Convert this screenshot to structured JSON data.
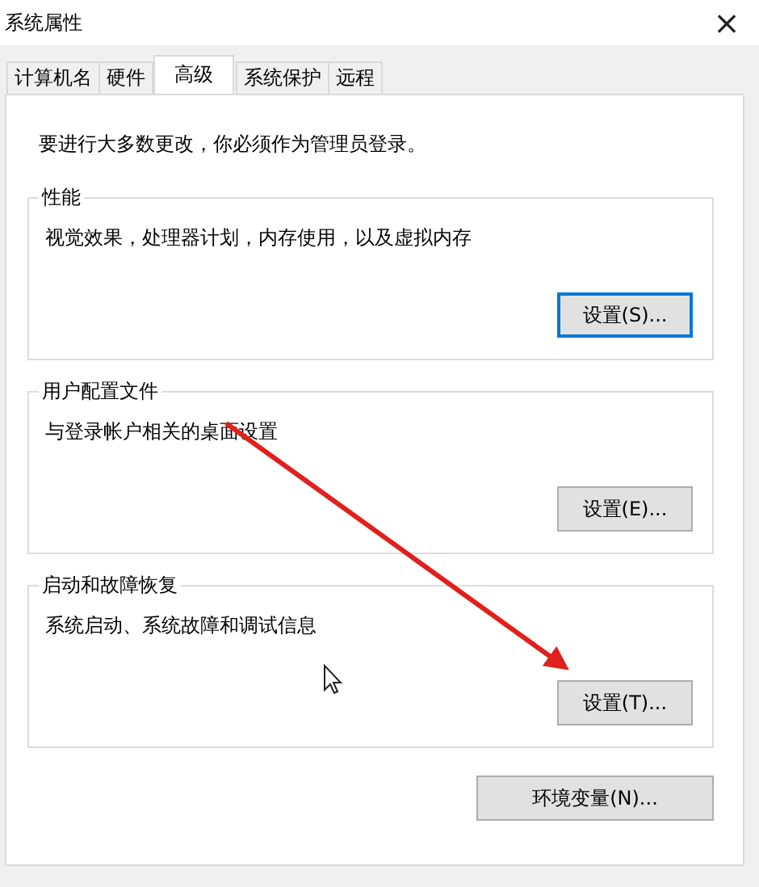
{
  "window": {
    "title": "系统属性",
    "close": "×"
  },
  "tabs": [
    {
      "label": "计算机名",
      "selected": false
    },
    {
      "label": "硬件",
      "selected": false
    },
    {
      "label": "高级",
      "selected": true
    },
    {
      "label": "系统保护",
      "selected": false
    },
    {
      "label": "远程",
      "selected": false
    }
  ],
  "notice": "要进行大多数更改，你必须作为管理员登录。",
  "groups": [
    {
      "title": "性能",
      "description": "视觉效果，处理器计划，内存使用，以及虚拟内存",
      "button": {
        "label": "设置(S)...",
        "focused": true
      }
    },
    {
      "title": "用户配置文件",
      "description": "与登录帐户相关的桌面设置",
      "button": {
        "label": "设置(E)...",
        "focused": false
      }
    },
    {
      "title": "启动和故障恢复",
      "description": "系统启动、系统故障和调试信息",
      "button": {
        "label": "设置(T)...",
        "focused": false
      }
    }
  ],
  "env_button": {
    "label": "环境变量(N)...",
    "focused": false
  }
}
